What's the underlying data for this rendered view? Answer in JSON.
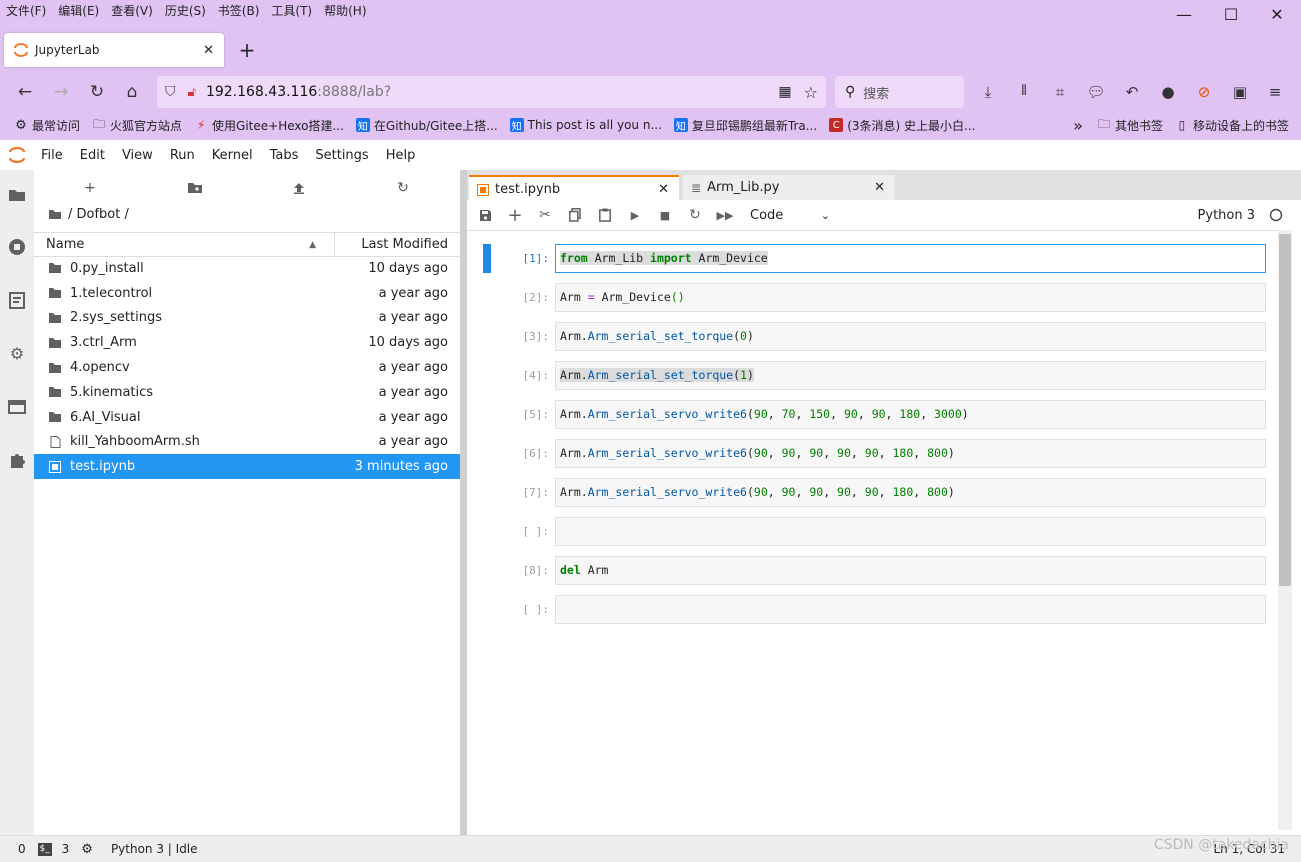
{
  "firefox": {
    "menu": [
      "文件(F)",
      "编辑(E)",
      "查看(V)",
      "历史(S)",
      "书签(B)",
      "工具(T)",
      "帮助(H)"
    ],
    "window_controls": [
      "—",
      "☐",
      "✕"
    ],
    "tab_title": "JupyterLab",
    "new_tab": "+",
    "url_host": "192.168.43.116",
    "url_rest": ":8888/lab?",
    "search_placeholder": "搜索",
    "bookmarks": [
      {
        "label": "最常访问",
        "icon": "gear-icon"
      },
      {
        "label": "火狐官方站点",
        "icon": "folder-icon"
      },
      {
        "label": "使用Gitee+Hexo搭建...",
        "icon": "bolt-icon"
      },
      {
        "label": "在Github/Gitee上搭...",
        "icon": "zhihu-icon"
      },
      {
        "label": "This post is all you n...",
        "icon": "zhihu-icon"
      },
      {
        "label": "复旦邱锡鹏组最新Tra...",
        "icon": "zhihu-icon"
      },
      {
        "label": "(3条消息) 史上最小白...",
        "icon": "csdn-icon"
      }
    ],
    "bookmarks_right": [
      "其他书签",
      "移动设备上的书签"
    ],
    "overflow": "»"
  },
  "jupyter": {
    "menu": [
      "File",
      "Edit",
      "View",
      "Run",
      "Kernel",
      "Tabs",
      "Settings",
      "Help"
    ],
    "file_browser": {
      "path": "/ Dofbot /",
      "col_name": "Name",
      "col_modified": "Last Modified",
      "files": [
        {
          "name": "0.py_install",
          "modified": "10 days ago",
          "type": "folder"
        },
        {
          "name": "1.telecontrol",
          "modified": "a year ago",
          "type": "folder"
        },
        {
          "name": "2.sys_settings",
          "modified": "a year ago",
          "type": "folder"
        },
        {
          "name": "3.ctrl_Arm",
          "modified": "10 days ago",
          "type": "folder"
        },
        {
          "name": "4.opencv",
          "modified": "a year ago",
          "type": "folder"
        },
        {
          "name": "5.kinematics",
          "modified": "a year ago",
          "type": "folder"
        },
        {
          "name": "6.AI_Visual",
          "modified": "a year ago",
          "type": "folder"
        },
        {
          "name": "kill_YahboomArm.sh",
          "modified": "a year ago",
          "type": "file"
        },
        {
          "name": "test.ipynb",
          "modified": "3 minutes ago",
          "type": "notebook",
          "selected": true
        }
      ]
    },
    "tabs": [
      {
        "label": "test.ipynb",
        "active": true
      },
      {
        "label": "Arm_Lib.py",
        "active": false
      }
    ],
    "cell_type": "Code",
    "kernel": "Python 3",
    "cells": [
      {
        "prompt": "[1]:"
      },
      {
        "prompt": "[2]:"
      },
      {
        "prompt": "[3]:"
      },
      {
        "prompt": "[4]:"
      },
      {
        "prompt": "[5]:"
      },
      {
        "prompt": "[6]:"
      },
      {
        "prompt": "[7]:"
      },
      {
        "prompt": "[ ]:"
      },
      {
        "prompt": "[8]:"
      },
      {
        "prompt": "[ ]:"
      }
    ],
    "status": {
      "terminals": "0",
      "kernels": "3",
      "kernel_state": "Python 3 | Idle",
      "cursor": "Ln 1, Col 31"
    }
  },
  "watermark": "CSDN @takedachia"
}
